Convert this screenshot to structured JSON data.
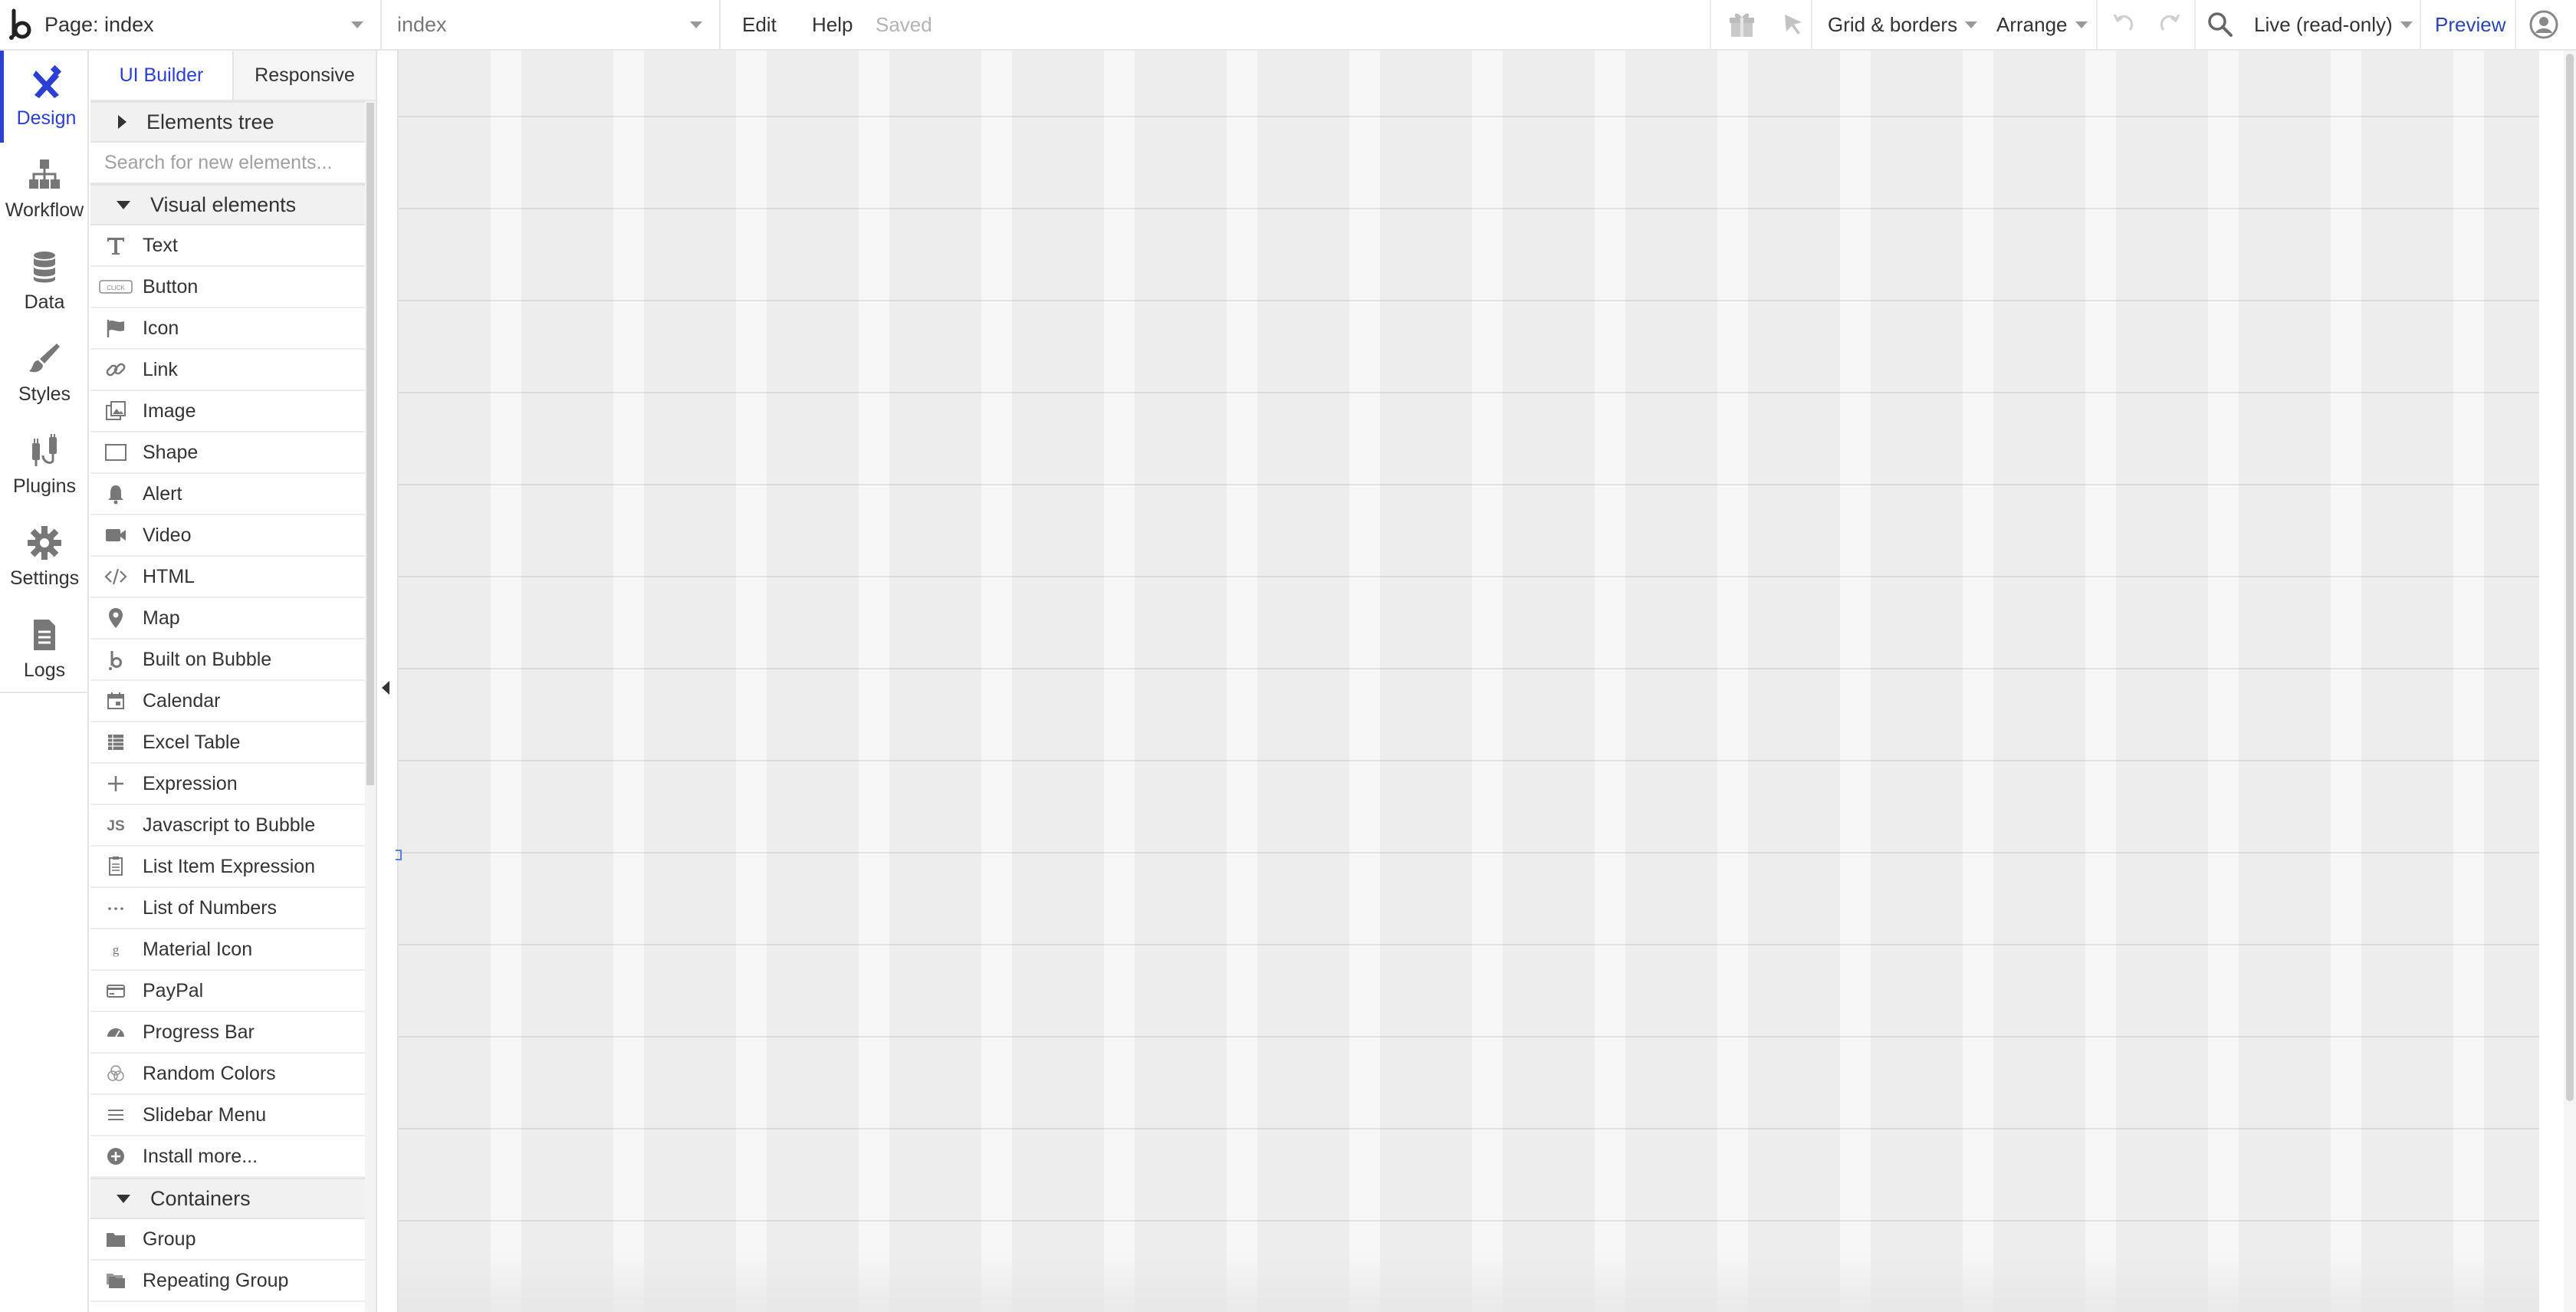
{
  "topbar": {
    "page_label": "Page: index",
    "view_label": "index",
    "menu_edit": "Edit",
    "menu_help": "Help",
    "saved_status": "Saved",
    "grid_borders": "Grid & borders",
    "arrange": "Arrange",
    "live_mode": "Live (read-only)",
    "preview": "Preview"
  },
  "nav": {
    "items": [
      {
        "label": "Design",
        "icon": "design-icon",
        "active": true
      },
      {
        "label": "Workflow",
        "icon": "workflow-icon"
      },
      {
        "label": "Data",
        "icon": "database-icon"
      },
      {
        "label": "Styles",
        "icon": "brush-icon"
      },
      {
        "label": "Plugins",
        "icon": "plug-icon"
      },
      {
        "label": "Settings",
        "icon": "gear-icon"
      },
      {
        "label": "Logs",
        "icon": "document-icon"
      }
    ]
  },
  "palette": {
    "tabs": [
      "UI Builder",
      "Responsive"
    ],
    "elements_tree": "Elements tree",
    "search_placeholder": "Search for new elements...",
    "visual_header": "Visual elements",
    "visual_items": [
      {
        "label": "Text",
        "icon": "text-icon"
      },
      {
        "label": "Button",
        "icon": "button-icon"
      },
      {
        "label": "Icon",
        "icon": "flag-icon"
      },
      {
        "label": "Link",
        "icon": "link-icon"
      },
      {
        "label": "Image",
        "icon": "image-icon"
      },
      {
        "label": "Shape",
        "icon": "shape-icon"
      },
      {
        "label": "Alert",
        "icon": "bell-icon"
      },
      {
        "label": "Video",
        "icon": "video-icon"
      },
      {
        "label": "HTML",
        "icon": "code-icon"
      },
      {
        "label": "Map",
        "icon": "map-pin-icon"
      },
      {
        "label": "Built on Bubble",
        "icon": "bubble-logo-icon"
      },
      {
        "label": "Calendar",
        "icon": "calendar-icon"
      },
      {
        "label": "Excel Table",
        "icon": "table-icon"
      },
      {
        "label": "Expression",
        "icon": "plus-icon"
      },
      {
        "label": "Javascript to Bubble",
        "icon": "js-icon"
      },
      {
        "label": "List Item Expression",
        "icon": "list-doc-icon"
      },
      {
        "label": "List of Numbers",
        "icon": "dots-icon"
      },
      {
        "label": "Material Icon",
        "icon": "material-g-icon"
      },
      {
        "label": "PayPal",
        "icon": "card-icon"
      },
      {
        "label": "Progress Bar",
        "icon": "gauge-icon"
      },
      {
        "label": "Random Colors",
        "icon": "palette-icon"
      },
      {
        "label": "Slidebar Menu",
        "icon": "hamburger-icon"
      },
      {
        "label": "Install more...",
        "icon": "plus-circle-icon"
      }
    ],
    "containers_header": "Containers",
    "container_items": [
      {
        "label": "Group",
        "icon": "folder-icon"
      },
      {
        "label": "Repeating Group",
        "icon": "repeating-folder-icon"
      }
    ],
    "icon_button_text": "CLICK",
    "icon_js_text": "JS",
    "icon_g_text": "g"
  }
}
